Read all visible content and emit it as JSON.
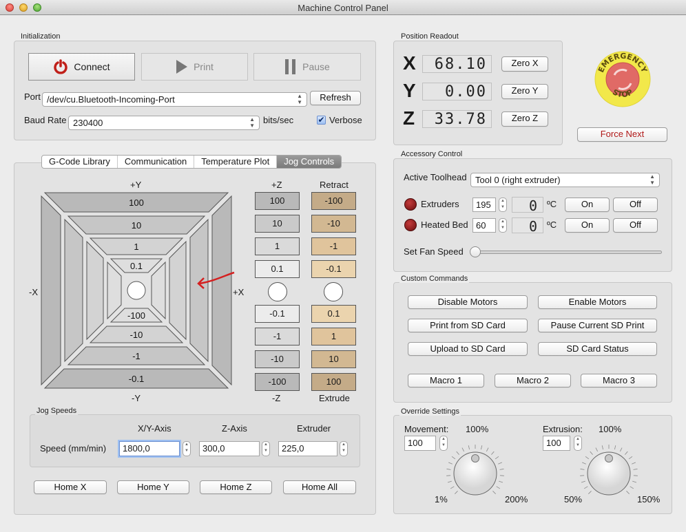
{
  "window": {
    "title": "Machine Control Panel"
  },
  "initialization": {
    "label": "Initialization",
    "connect_label": "Connect",
    "print_label": "Print",
    "pause_label": "Pause",
    "port_label": "Port",
    "port_value": "/dev/cu.Bluetooth-Incoming-Port",
    "refresh_label": "Refresh",
    "baud_label": "Baud Rate",
    "baud_value": "230400",
    "baud_unit": "bits/sec",
    "verbose_label": "Verbose",
    "verbose_checked": true
  },
  "position": {
    "label": "Position Readout",
    "axes": [
      {
        "letter": "X",
        "value": "68.10",
        "button": "Zero X"
      },
      {
        "letter": "Y",
        "value": "0.00",
        "button": "Zero Y"
      },
      {
        "letter": "Z",
        "value": "33.78",
        "button": "Zero Z"
      }
    ]
  },
  "emergency": {
    "top_text": "EMERGENCY",
    "bottom_text": "STOP",
    "force_next_label": "Force Next"
  },
  "tabs": [
    {
      "label": "G-Code Library",
      "active": false
    },
    {
      "label": "Communication",
      "active": false
    },
    {
      "label": "Temperature Plot",
      "active": false
    },
    {
      "label": "Jog Controls",
      "active": true
    }
  ],
  "jog": {
    "plus_y": "+Y",
    "minus_y": "-Y",
    "plus_x": "+X",
    "minus_x": "-X",
    "plus_z": "+Z",
    "minus_z": "-Z",
    "retract": "Retract",
    "extrude": "Extrude",
    "xy_top": [
      "100",
      "10",
      "1",
      "0.1"
    ],
    "xy_bottom": [
      "-0.1",
      "-1",
      "-10",
      "-100"
    ],
    "z_top": [
      "100",
      "10",
      "1",
      "0.1"
    ],
    "z_bottom": [
      "-0.1",
      "-1",
      "-10",
      "-100"
    ],
    "e_top": [
      "-100",
      "-10",
      "-1",
      "-0.1"
    ],
    "e_bottom": [
      "0.1",
      "1",
      "10",
      "100"
    ]
  },
  "jog_speeds": {
    "label": "Jog Speeds",
    "row_label": "Speed (mm/min)",
    "columns": [
      {
        "header": "X/Y-Axis",
        "value": "1800,0"
      },
      {
        "header": "Z-Axis",
        "value": "300,0"
      },
      {
        "header": "Extruder",
        "value": "225,0"
      }
    ]
  },
  "home": [
    "Home X",
    "Home Y",
    "Home Z",
    "Home All"
  ],
  "accessory": {
    "label": "Accessory Control",
    "toolhead_label": "Active Toolhead",
    "toolhead_value": "Tool 0 (right extruder)",
    "extruders_label": "Extruders",
    "extruders_target": "195",
    "extruders_current": "0",
    "bed_label": "Heated Bed",
    "bed_target": "60",
    "bed_current": "0",
    "unit": "ºC",
    "on_label": "On",
    "off_label": "Off",
    "fan_label": "Set Fan Speed",
    "fan_value": 0
  },
  "custom": {
    "label": "Custom Commands",
    "buttons": [
      "Disable Motors",
      "Enable Motors",
      "Print from SD Card",
      "Pause Current SD Print",
      "Upload to SD Card",
      "SD Card Status"
    ],
    "macros": [
      "Macro 1",
      "Macro 2",
      "Macro 3"
    ]
  },
  "override": {
    "label": "Override Settings",
    "movement": {
      "label": "Movement:",
      "value": "100",
      "center": "100%",
      "min": "1%",
      "max": "200%"
    },
    "extrusion": {
      "label": "Extrusion:",
      "value": "100",
      "center": "100%",
      "min": "50%",
      "max": "150%"
    }
  }
}
